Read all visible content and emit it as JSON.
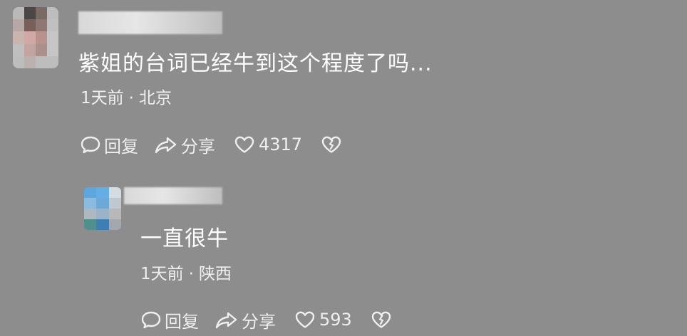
{
  "comment": {
    "text": "紫姐的台词已经牛到这个程度了吗...",
    "time": "1天前",
    "separator": "·",
    "location": "北京",
    "actions": {
      "reply_label": "回复",
      "share_label": "分享",
      "like_count": "4317"
    },
    "avatar_colors": [
      "#b9b9b9",
      "#4b4747",
      "#7a6a64",
      "#bdbdbd",
      "#b7a8a8",
      "#785f58",
      "#8f7874",
      "#c0c0c0",
      "#c9b4b0",
      "#d0a8a6",
      "#b9928d",
      "#c6c6c6",
      "#bfbfbf",
      "#c4a4a0",
      "#ab8f8a",
      "#c6c6c6",
      "#bdbdbd",
      "#bbb2b0",
      "#bdbdbd",
      "#bdbdbd"
    ],
    "icons": {
      "reply": "chat-bubble-icon",
      "share": "share-arrow-icon",
      "like": "heart-icon",
      "dislike": "broken-heart-icon"
    }
  },
  "reply": {
    "text": "一直很牛",
    "time": "1天前",
    "separator": "·",
    "location": "陕西",
    "actions": {
      "reply_label": "回复",
      "share_label": "分享",
      "like_count": "593"
    },
    "avatar_colors": [
      "#5ea7de",
      "#63aee3",
      "#d6dbe0",
      "#8cbbe0",
      "#6ca8d8",
      "#bfc7cf",
      "#aeb8c1",
      "#9bb3c7",
      "#b8b8b8",
      "#4f8f8c",
      "#3d7fb3",
      "#a2a8ad"
    ],
    "icons": {
      "reply": "chat-bubble-icon",
      "share": "share-arrow-icon",
      "like": "heart-icon",
      "dislike": "broken-heart-icon"
    }
  }
}
